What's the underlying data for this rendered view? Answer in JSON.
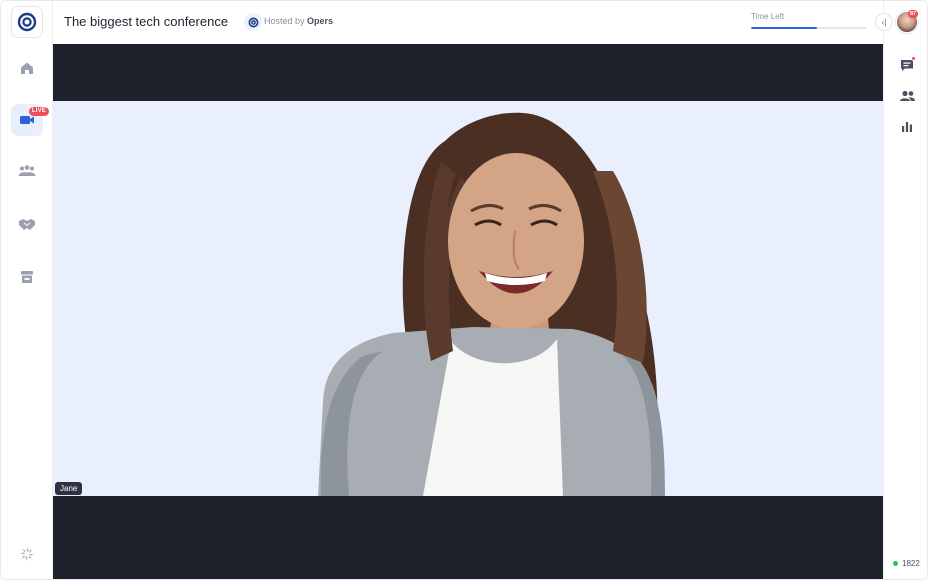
{
  "header": {
    "title": "The biggest tech conference",
    "host_prefix": "Hosted by",
    "host_name": "Opers",
    "time_left_label": "Time Left",
    "time_left_progress_pct": 57
  },
  "sidebar": {
    "items": [
      {
        "name": "home",
        "icon": "home-icon"
      },
      {
        "name": "live-stage",
        "icon": "video-camera-icon",
        "badge": "LIVE",
        "active": true
      },
      {
        "name": "sessions",
        "icon": "group-icon"
      },
      {
        "name": "networking",
        "icon": "handshake-icon"
      },
      {
        "name": "expo",
        "icon": "booth-icon"
      }
    ],
    "bottom_icon": "spinner-icon"
  },
  "right_rail": {
    "collapse_glyph": "‹|",
    "avatar_badge": "87",
    "items": [
      "chat-icon",
      "people-icon",
      "poll-icon"
    ],
    "online_count": "1822"
  },
  "stage": {
    "speaker_name": "Jane"
  },
  "colors": {
    "accent": "#2f5fe0",
    "live": "#ef4b5a",
    "stage_bg": "#1c212c",
    "video_bg": "#eaeffd",
    "online": "#22c55e"
  }
}
